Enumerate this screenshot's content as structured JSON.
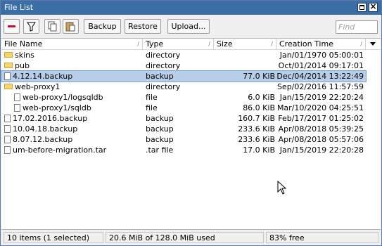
{
  "window": {
    "title": "File List"
  },
  "toolbar": {
    "backup_label": "Backup",
    "restore_label": "Restore",
    "upload_label": "Upload...",
    "find_placeholder": "Find"
  },
  "columns": {
    "name": "File Name",
    "type": "Type",
    "size": "Size",
    "ctime": "Creation Time"
  },
  "files": [
    {
      "name": "skins",
      "type": "directory",
      "size": "",
      "ctime": "Jan/01/1970 05:00:01",
      "icon": "folder-icon",
      "indent": false
    },
    {
      "name": "pub",
      "type": "directory",
      "size": "",
      "ctime": "Oct/01/2014 09:17:01",
      "icon": "folder-icon",
      "indent": false
    },
    {
      "name": "4.12.14.backup",
      "type": "backup",
      "size": "77.0 KiB",
      "ctime": "Dec/04/2014 13:22:49",
      "icon": "file-icon",
      "indent": false,
      "selected": true
    },
    {
      "name": "web-proxy1",
      "type": "directory",
      "size": "",
      "ctime": "Sep/02/2016 11:57:59",
      "icon": "folder-icon",
      "indent": false
    },
    {
      "name": "web-proxy1/logsqldb",
      "type": "file",
      "size": "6.0 KiB",
      "ctime": "Jan/15/2019 22:20:24",
      "icon": "file-icon",
      "indent": true
    },
    {
      "name": "web-proxy1/sqldb",
      "type": "file",
      "size": "86.0 KiB",
      "ctime": "Mar/10/2020 04:25:51",
      "icon": "file-icon",
      "indent": true
    },
    {
      "name": "17.02.2016.backup",
      "type": "backup",
      "size": "160.7 KiB",
      "ctime": "Feb/17/2017 01:25:02",
      "icon": "file-icon",
      "indent": false
    },
    {
      "name": "10.04.18.backup",
      "type": "backup",
      "size": "233.6 KiB",
      "ctime": "Apr/08/2018 05:39:25",
      "icon": "file-icon",
      "indent": false
    },
    {
      "name": "8.07.12.backup",
      "type": "backup",
      "size": "233.6 KiB",
      "ctime": "Apr/08/2018 05:57:06",
      "icon": "file-icon",
      "indent": false
    },
    {
      "name": "um-before-migration.tar",
      "type": ".tar file",
      "size": "17.0 KiB",
      "ctime": "Jan/15/2019 22:20:28",
      "icon": "file-icon",
      "indent": false
    }
  ],
  "status": {
    "items": "10 items (1 selected)",
    "used": "20.6 MiB of 128.0 MiB used",
    "free": "83% free"
  },
  "colors": {
    "titlebar": "#3a6ea5",
    "selection": "#b7cde8",
    "folder": "#f5d66b",
    "remove_button": "#c8102e"
  }
}
